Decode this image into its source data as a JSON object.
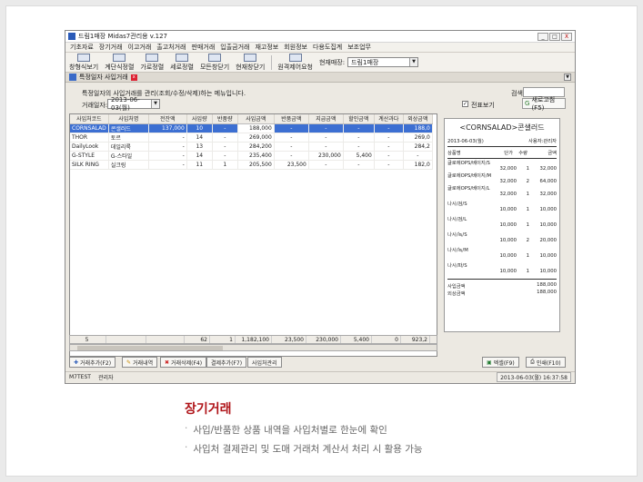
{
  "app": {
    "title": "드림1매장 Midas7관리용 v.127",
    "min": "_",
    "max": "□",
    "close": "X"
  },
  "menu": [
    "기초자료",
    "장기거래",
    "이고거래",
    "출고처거래",
    "판매거래",
    "입출금거래",
    "재고정보",
    "회원정보",
    "다용도집계",
    "보조업무"
  ],
  "toolbar": {
    "buttons": [
      "창형식보기",
      "계단식정렬",
      "가로정렬",
      "세로정렬",
      "모든창닫기",
      "현재창닫기",
      "원격제어요청"
    ],
    "store_label": "현재매장:",
    "store_value": "드림1매장"
  },
  "tab": {
    "label": "특정일자 사입거래"
  },
  "form": {
    "desc": "특정일자의 사입거래를 관리(조회/수정/삭제)하는 메뉴입니다.",
    "date_label": "거래일자:",
    "date_value": "2013-06-03(월)",
    "search_label": "검색:",
    "slip_label": "전표보기",
    "refresh": "새로고침(F5)"
  },
  "grid": {
    "columns": [
      "사입처코드",
      "사입처명",
      "전잔액",
      "사입량",
      "반품량",
      "사입금액",
      "반품금액",
      "지급금액",
      "할인금액",
      "계산과다",
      "외상금액"
    ],
    "rows": [
      [
        "CORNSALAD",
        "콘샐러드",
        "137,000",
        "10",
        "-",
        "188,000",
        "-",
        "-",
        "-",
        "-",
        "188,0"
      ],
      [
        "THOR",
        "토르",
        "-",
        "14",
        "-",
        "269,000",
        "-",
        "-",
        "-",
        "-",
        "269,0"
      ],
      [
        "DailyLook",
        "데일리룩",
        "-",
        "13",
        "-",
        "284,200",
        "-",
        "-",
        "-",
        "-",
        "284,2"
      ],
      [
        "G-STYLE",
        "G-스타일",
        "-",
        "14",
        "-",
        "235,400",
        "-",
        "230,000",
        "5,400",
        "-",
        "-"
      ],
      [
        "SILK RING",
        "실크링",
        "-",
        "11",
        "1",
        "205,500",
        "23,500",
        "-",
        "-",
        "-",
        "182,0"
      ]
    ],
    "footer": [
      "5",
      "",
      "",
      "62",
      "1",
      "1,182,100",
      "23,500",
      "230,000",
      "5,400",
      "0",
      "923,2"
    ]
  },
  "receipt": {
    "title": "<CORNSALAD>콘샐러드",
    "date": "2013-06-03(월)",
    "user": "사용자:관리자",
    "header": [
      "상품명",
      "단가",
      "수량",
      "금액"
    ],
    "items": [
      {
        "name": "글로에OPS/베이지/S",
        "price": "32,000",
        "qty": "1",
        "amt": "32,000"
      },
      {
        "name": "글로에OPS/베이지/M",
        "price": "32,000",
        "qty": "2",
        "amt": "64,000"
      },
      {
        "name": "글로에OPS/베이지/L",
        "price": "32,000",
        "qty": "1",
        "amt": "32,000"
      },
      {
        "name": "나시/검/S",
        "price": "10,000",
        "qty": "1",
        "amt": "10,000"
      },
      {
        "name": "나시/검/L",
        "price": "10,000",
        "qty": "1",
        "amt": "10,000"
      },
      {
        "name": "나시/녹/S",
        "price": "10,000",
        "qty": "2",
        "amt": "20,000"
      },
      {
        "name": "나시/녹/M",
        "price": "10,000",
        "qty": "1",
        "amt": "10,000"
      },
      {
        "name": "나시/파/S",
        "price": "10,000",
        "qty": "1",
        "amt": "10,000"
      }
    ],
    "total_label": "사입금액",
    "total": "188,000",
    "credit_label": "외상금액",
    "credit": "188,000"
  },
  "buttons": {
    "add": "거래추가(F2)",
    "detail": "거래내역",
    "delete": "거래삭제(F4)",
    "settle": "결제추가(F7)",
    "vendor": "사입처관리",
    "excel": "엑셀(F9)",
    "print": "인쇄(F10)"
  },
  "status": {
    "left": "M7TEST",
    "user": "관리자",
    "time": "2013-06-03(월) 16:37:58"
  },
  "caption": {
    "title": "장기거래",
    "bullets": [
      "사입/반품한 상품 내역을 사입처별로 한눈에 확인",
      "사입처 결제관리 및 도매 거래처 계산서 처리 시 활용 가능"
    ]
  }
}
